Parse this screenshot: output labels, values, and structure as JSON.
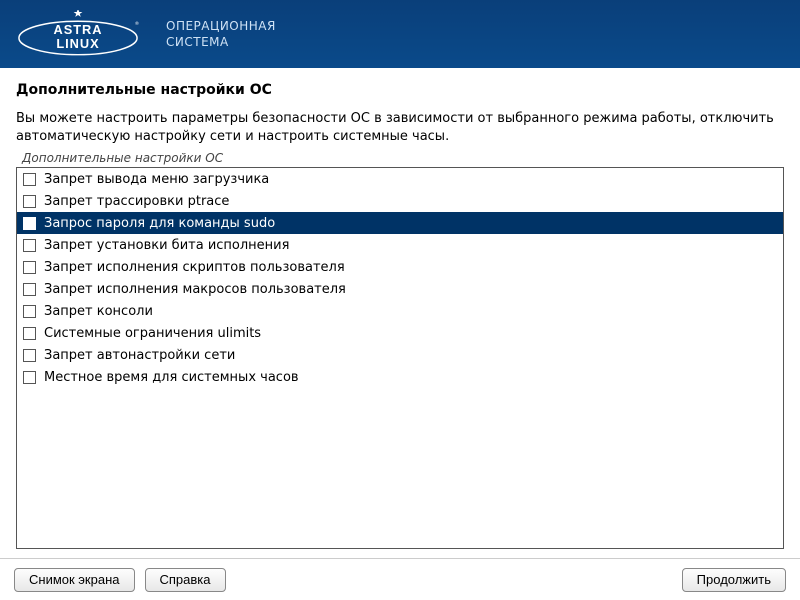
{
  "header": {
    "brand_astra": "ASTRA",
    "brand_linux": "LINUX",
    "subtitle_line1": "ОПЕРАЦИОННАЯ",
    "subtitle_line2": "СИСТЕМА"
  },
  "page": {
    "title": "Дополнительные настройки ОС",
    "description": "Вы можете настроить параметры безопасности ОС в зависимости от выбранного режима работы, отключить автоматическую настройку сети и настроить системные часы.",
    "group_label": "Дополнительные настройки ОС"
  },
  "options": [
    {
      "label": "Запрет вывода меню загрузчика",
      "checked": false,
      "selected": false
    },
    {
      "label": "Запрет трассировки ptrace",
      "checked": false,
      "selected": false
    },
    {
      "label": "Запрос пароля для команды sudo",
      "checked": true,
      "selected": true
    },
    {
      "label": "Запрет установки бита исполнения",
      "checked": false,
      "selected": false
    },
    {
      "label": "Запрет исполнения скриптов пользователя",
      "checked": false,
      "selected": false
    },
    {
      "label": "Запрет исполнения макросов пользователя",
      "checked": false,
      "selected": false
    },
    {
      "label": "Запрет консоли",
      "checked": false,
      "selected": false
    },
    {
      "label": "Системные ограничения ulimits",
      "checked": false,
      "selected": false
    },
    {
      "label": "Запрет автонастройки сети",
      "checked": false,
      "selected": false
    },
    {
      "label": "Местное время для системных часов",
      "checked": false,
      "selected": false
    }
  ],
  "footer": {
    "screenshot": "Снимок экрана",
    "help": "Справка",
    "continue": "Продолжить"
  }
}
